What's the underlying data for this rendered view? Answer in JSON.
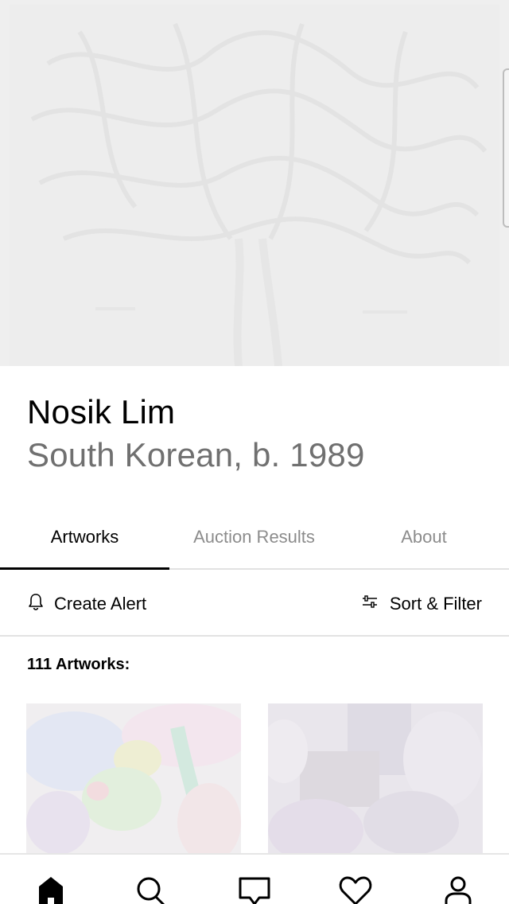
{
  "artist": {
    "name": "Nosik Lim",
    "meta": "South Korean, b. 1989"
  },
  "tabs": [
    {
      "label": "Artworks",
      "active": true
    },
    {
      "label": "Auction Results",
      "active": false
    },
    {
      "label": "About",
      "active": false
    }
  ],
  "toolbar": {
    "create_alert_label": "Create Alert",
    "sort_filter_label": "Sort & Filter"
  },
  "artworks_count_label": "111 Artworks:",
  "bottom_nav": [
    {
      "name": "home",
      "icon": "home-icon",
      "active": true
    },
    {
      "name": "search",
      "icon": "search-icon",
      "active": false
    },
    {
      "name": "inbox",
      "icon": "inbox-icon",
      "active": false
    },
    {
      "name": "saves",
      "icon": "heart-icon",
      "active": false
    },
    {
      "name": "profile",
      "icon": "person-icon",
      "active": false
    }
  ],
  "colors": {
    "primary_text": "#000000",
    "secondary_text": "#707070",
    "inactive_tab": "#8c8c8c",
    "divider": "#e2e2e2"
  }
}
